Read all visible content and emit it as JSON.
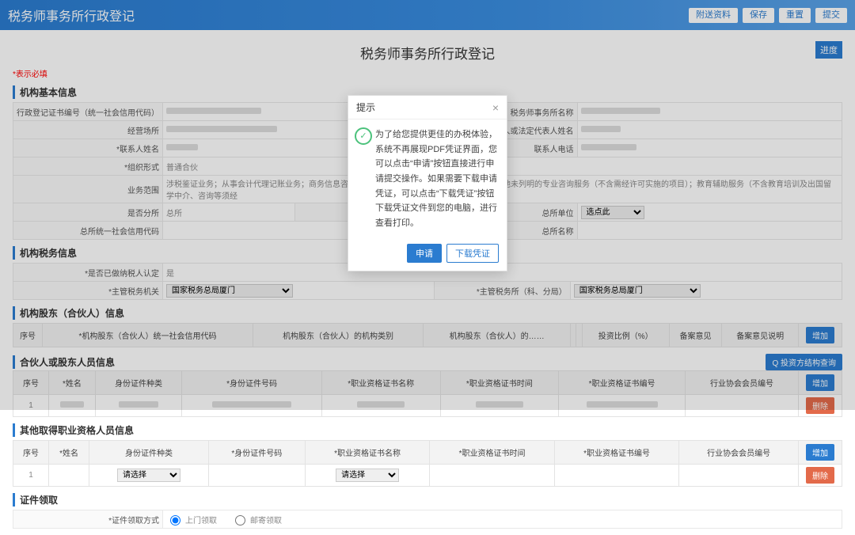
{
  "header": {
    "title": "税务师事务所行政登记",
    "btns": [
      "附送资料",
      "保存",
      "重置",
      "提交"
    ]
  },
  "page_title": "税务师事务所行政登记",
  "progress_label": "进度",
  "required_note": "*表示必填",
  "section": {
    "basic": "机构基本信息",
    "tax": "机构税务信息",
    "shareholder": "机构股东（合伙人）信息",
    "partner_person": "合伙人或股东人员信息",
    "other_cert": "其他取得职业资格人员信息",
    "cert_receive": "证件领取"
  },
  "basic": {
    "l1a": "行政登记证书编号（统一社会信用代码）",
    "l1b": "税务师事务所名称",
    "l2a": "经营场所",
    "l2b": "执行事务合伙人或法定代表人姓名",
    "l3a": "*联系人姓名",
    "l3b": "联系人电话",
    "l4a": "*组织形式",
    "v4a": "普通合伙",
    "l5a": "业务范围",
    "v5a": "涉税鉴证业务；从事会计代理记账业务；商务信息咨询；",
    "v5b": "涉税许可实施的项目）；其他未列明的专业咨询服务（不含需经许可实施的项目）；教育辅助服务（不含教育培训及出国留学中介、咨询等须经",
    "l6a": "是否分所",
    "v6a": "总所",
    "l6b": "总所单位",
    "v6b": "选点此",
    "l7a": "总所统一社会信用代码",
    "l7b": "总所名称"
  },
  "tax": {
    "l1": "*是否已做纳税人认定",
    "v1": "是",
    "l2": "*主管税务机关",
    "v2": "国家税务总局厦门",
    "l3": "*主管税务所（科、分局）",
    "v3": "国家税务总局厦门"
  },
  "sh_cols": [
    "序号",
    "*机构股东（合伙人）统一社会信用代码",
    "机构股东（合伙人）的机构类别",
    "机构股东（合伙人）的……",
    "",
    "",
    "投资比例（%）",
    "备案意见",
    "备案意见说明"
  ],
  "sh_add": "增加",
  "sh_view": "Q 投资方结构查询",
  "pp_cols": [
    "序号",
    "*姓名",
    "身份证件种类",
    "*身份证件号码",
    "*职业资格证书名称",
    "*职业资格证书时间",
    "*职业资格证书编号",
    "行业协会会员编号"
  ],
  "pp_row_idx": "1",
  "pp_sel": "请选择",
  "pp_add": "增加",
  "pp_del": "删除",
  "cert": {
    "label": "*证件领取方式",
    "opt1": "上门领取",
    "opt2": "邮寄领取"
  },
  "modal": {
    "title": "提示",
    "body": "为了给您提供更佳的办税体验，系统不再展现PDF凭证界面，您可以点击“申请”按钮直接进行申请提交操作。如果需要下载申请凭证，可以点击“下载凭证”按钮下载凭证文件到您的电脑，进行查看打印。",
    "btn_apply": "申请",
    "btn_dl": "下载凭证"
  }
}
